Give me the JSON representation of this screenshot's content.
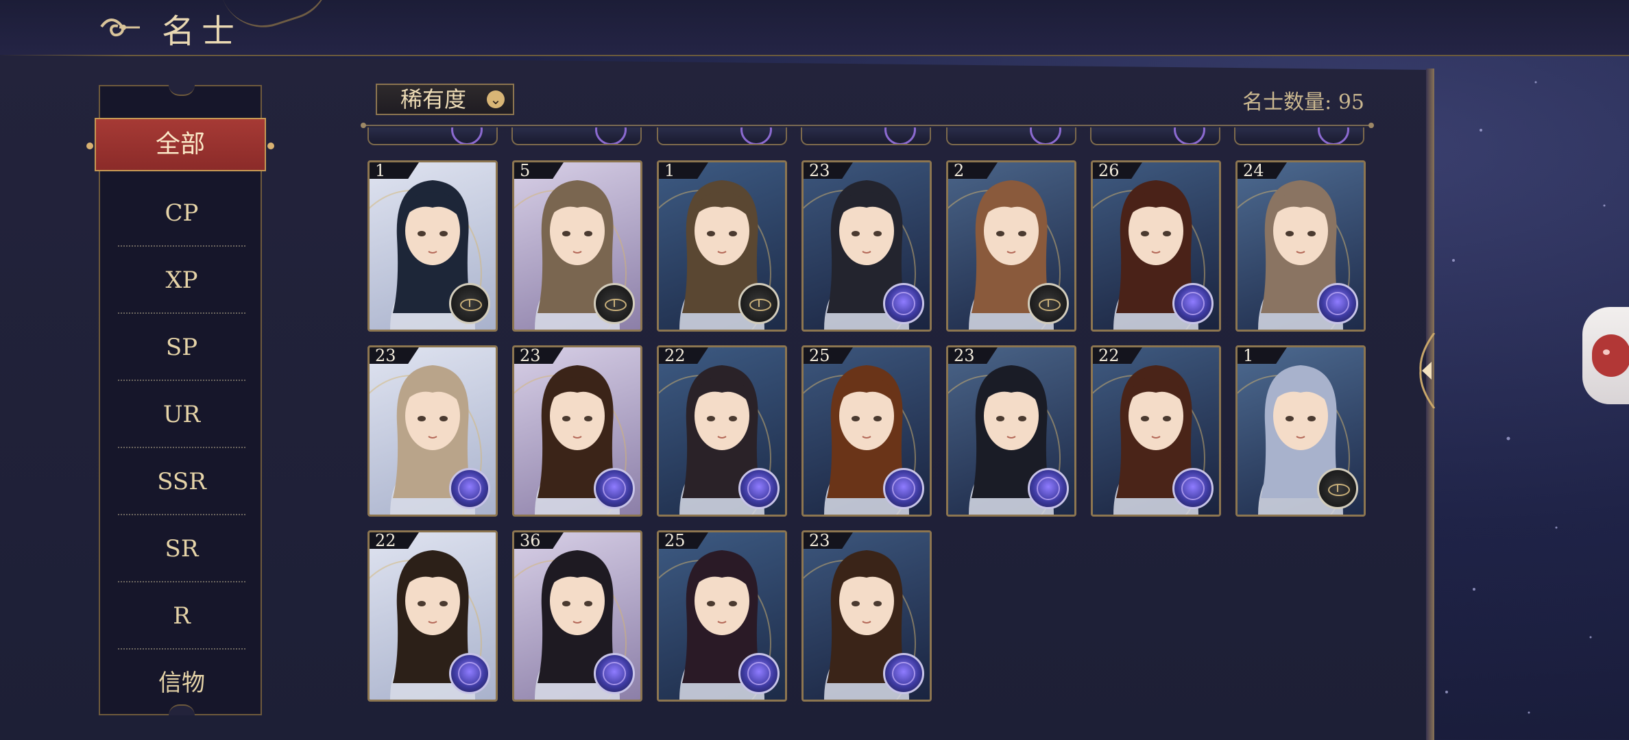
{
  "header": {
    "title": "名士",
    "icon": "cloud-swirl-icon"
  },
  "sidebar": {
    "active_label": "全部",
    "items": [
      {
        "label": "CP"
      },
      {
        "label": "XP"
      },
      {
        "label": "SP"
      },
      {
        "label": "UR"
      },
      {
        "label": "SSR"
      },
      {
        "label": "SR"
      },
      {
        "label": "R"
      },
      {
        "label": "信物"
      }
    ]
  },
  "filter": {
    "label": "稀有度",
    "icon": "chevron-down-icon"
  },
  "count": {
    "label": "名士数量: 95"
  },
  "colors": {
    "accent_red": "#a63a35",
    "gold": "#c79a55",
    "text_gold": "#e6d4a8"
  },
  "cards": [
    {
      "level": "1",
      "badge": "compass-icon"
    },
    {
      "level": "5",
      "badge": "compass-icon"
    },
    {
      "level": "1",
      "badge": "compass-icon"
    },
    {
      "level": "23",
      "badge": "orb-icon"
    },
    {
      "level": "2",
      "badge": "compass-icon"
    },
    {
      "level": "26",
      "badge": "orb-icon"
    },
    {
      "level": "24",
      "badge": "orb-icon"
    },
    {
      "level": "23",
      "badge": "orb-icon"
    },
    {
      "level": "23",
      "badge": "orb-icon"
    },
    {
      "level": "22",
      "badge": "orb-icon"
    },
    {
      "level": "25",
      "badge": "orb-icon"
    },
    {
      "level": "23",
      "badge": "orb-icon"
    },
    {
      "level": "22",
      "badge": "orb-icon"
    },
    {
      "level": "1",
      "badge": "compass-icon"
    },
    {
      "level": "22",
      "badge": "orb-icon"
    },
    {
      "level": "36",
      "badge": "orb-icon"
    },
    {
      "level": "25",
      "badge": "orb-icon"
    },
    {
      "level": "23",
      "badge": "orb-icon"
    }
  ],
  "side_controls": {
    "collapse_icon": "arrow-left-icon",
    "floating_button_icon": "chat-bubble-icon"
  }
}
